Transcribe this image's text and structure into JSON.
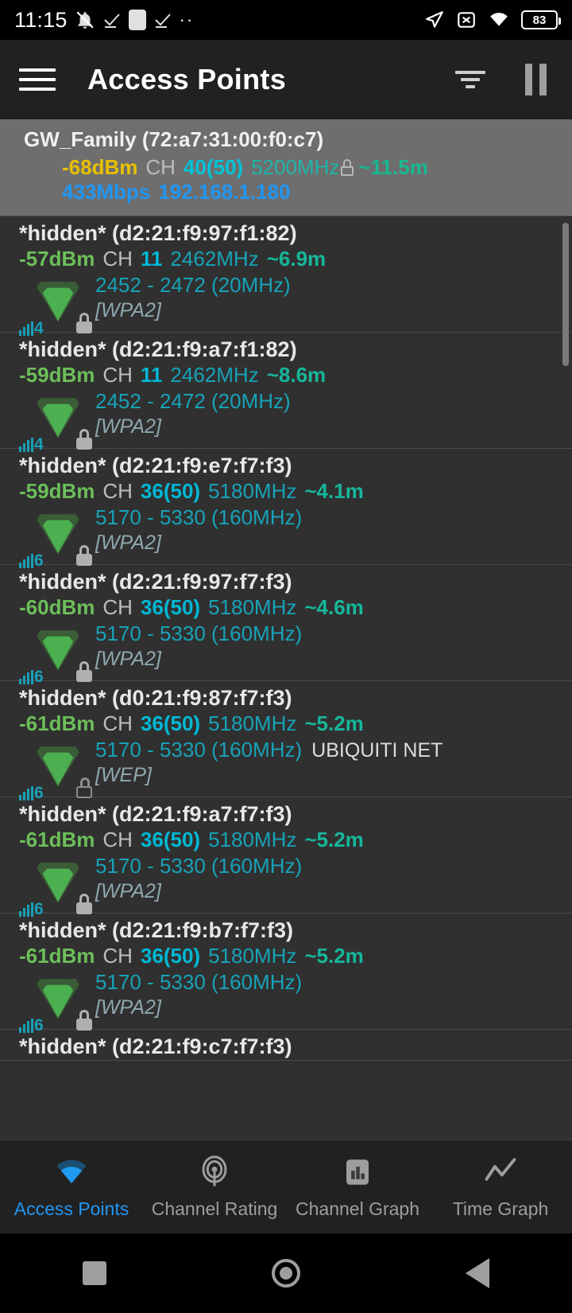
{
  "statusbar": {
    "time": "11:15",
    "battery": "83",
    "icons": [
      "bell-off-icon",
      "check-icon",
      "app-icon",
      "check-icon",
      "more-dots-icon",
      "location-arrow-icon",
      "sim-off-icon",
      "wifi-icon",
      "battery-icon"
    ]
  },
  "appbar": {
    "menu_icon": "hamburger-menu-icon",
    "title": "Access Points",
    "filter_icon": "filter-icon",
    "pause_icon": "pause-icon"
  },
  "connected": {
    "ssid_line": "GW_Family (72:a7:31:00:f0:c7)",
    "level": "-68dBm",
    "ch_label": "CH",
    "channel": "40(50)",
    "frequency": "5200MHz",
    "lock_icon": "lock-icon",
    "distance": "~11.5m",
    "speed": "433Mbps",
    "ip": "192.168.1.180"
  },
  "access_points": [
    {
      "ssid": "*hidden* (d2:21:f9:97:f1:82)",
      "level": "-57dBm",
      "ch_label": "CH",
      "channel": "11",
      "frequency": "2462MHz",
      "distance": "~6.9m",
      "range": "2452 - 2472 (20MHz)",
      "vendor": "",
      "security": "[WPA2]",
      "wifi_std": "4",
      "lock": "closed"
    },
    {
      "ssid": "*hidden* (d2:21:f9:a7:f1:82)",
      "level": "-59dBm",
      "ch_label": "CH",
      "channel": "11",
      "frequency": "2462MHz",
      "distance": "~8.6m",
      "range": "2452 - 2472 (20MHz)",
      "vendor": "",
      "security": "[WPA2]",
      "wifi_std": "4",
      "lock": "closed"
    },
    {
      "ssid": "*hidden* (d2:21:f9:e7:f7:f3)",
      "level": "-59dBm",
      "ch_label": "CH",
      "channel": "36(50)",
      "frequency": "5180MHz",
      "distance": "~4.1m",
      "range": "5170 - 5330 (160MHz)",
      "vendor": "",
      "security": "[WPA2]",
      "wifi_std": "6",
      "lock": "closed"
    },
    {
      "ssid": "*hidden* (d2:21:f9:97:f7:f3)",
      "level": "-60dBm",
      "ch_label": "CH",
      "channel": "36(50)",
      "frequency": "5180MHz",
      "distance": "~4.6m",
      "range": "5170 - 5330 (160MHz)",
      "vendor": "",
      "security": "[WPA2]",
      "wifi_std": "6",
      "lock": "closed"
    },
    {
      "ssid": "*hidden* (d0:21:f9:87:f7:f3)",
      "level": "-61dBm",
      "ch_label": "CH",
      "channel": "36(50)",
      "frequency": "5180MHz",
      "distance": "~5.2m",
      "range": "5170 - 5330 (160MHz)",
      "vendor": "UBIQUITI NET",
      "security": "[WEP]",
      "wifi_std": "6",
      "lock": "open"
    },
    {
      "ssid": "*hidden* (d2:21:f9:a7:f7:f3)",
      "level": "-61dBm",
      "ch_label": "CH",
      "channel": "36(50)",
      "frequency": "5180MHz",
      "distance": "~5.2m",
      "range": "5170 - 5330 (160MHz)",
      "vendor": "",
      "security": "[WPA2]",
      "wifi_std": "6",
      "lock": "closed"
    },
    {
      "ssid": "*hidden* (d2:21:f9:b7:f7:f3)",
      "level": "-61dBm",
      "ch_label": "CH",
      "channel": "36(50)",
      "frequency": "5180MHz",
      "distance": "~5.2m",
      "range": "5170 - 5330 (160MHz)",
      "vendor": "",
      "security": "[WPA2]",
      "wifi_std": "6",
      "lock": "closed"
    }
  ],
  "partial_ap": {
    "ssid": "*hidden* (d2:21:f9:c7:f7:f3)"
  },
  "bottom_nav": [
    {
      "label": "Access Points",
      "icon": "wifi-fan-icon",
      "active": true
    },
    {
      "label": "Channel Rating",
      "icon": "radar-icon",
      "active": false
    },
    {
      "label": "Channel Graph",
      "icon": "bar-chart-icon",
      "active": false
    },
    {
      "label": "Time Graph",
      "icon": "line-chart-icon",
      "active": false
    }
  ],
  "system_nav": [
    "recents-square-icon",
    "home-circle-icon",
    "back-triangle-icon"
  ],
  "colors": {
    "accent": "#2196f3",
    "signal_green": "#6cbf5a",
    "channel_cyan": "#00b8d4",
    "freq_teal": "#17a2b8",
    "distance_teal": "#16b79b",
    "connected_level": "#e8c000",
    "background": "#303030",
    "appbar": "#212121"
  }
}
